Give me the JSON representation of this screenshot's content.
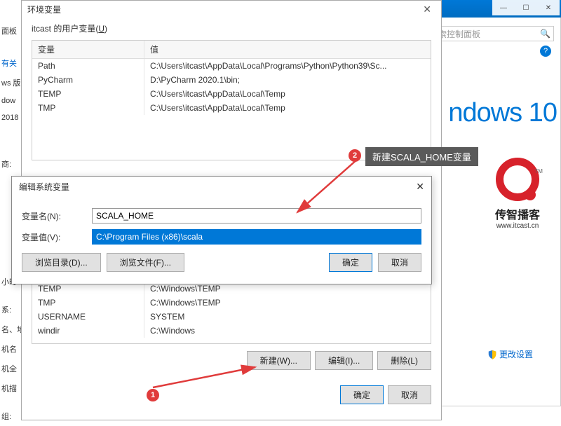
{
  "background": {
    "search_placeholder": "搜索控制面板",
    "windows_brand": "ndows 10",
    "logo_name": "传智播客",
    "logo_url": "www.itcast.cn",
    "change_settings": "更改设置",
    "left_items": [
      "面板",
      "有关",
      "ws 版",
      "dow",
      "2018",
      "商:",
      "小时",
      "系:",
      "名、地",
      "机名",
      "机全",
      "机描",
      "组:"
    ],
    "winbtns": [
      "—",
      "☐",
      "✕"
    ]
  },
  "env_window": {
    "title": "环境变量",
    "close": "✕",
    "user_group_label_pre": "itcast 的用户变量(",
    "user_group_label_u": "U",
    "user_group_label_post": ")",
    "col_var": "变量",
    "col_val": "值",
    "user_vars": [
      {
        "name": "Path",
        "value": "C:\\Users\\itcast\\AppData\\Local\\Programs\\Python\\Python39\\Sc..."
      },
      {
        "name": "PyCharm",
        "value": "D:\\PyCharm 2020.1\\bin;"
      },
      {
        "name": "TEMP",
        "value": "C:\\Users\\itcast\\AppData\\Local\\Temp"
      },
      {
        "name": "TMP",
        "value": "C:\\Users\\itcast\\AppData\\Local\\Temp"
      }
    ],
    "sys_vars_visible": [
      {
        "name": "TEMP",
        "value": "C:\\Windows\\TEMP"
      },
      {
        "name": "TMP",
        "value": "C:\\Windows\\TEMP"
      },
      {
        "name": "USERNAME",
        "value": "SYSTEM"
      },
      {
        "name": "windir",
        "value": "C:\\Windows"
      }
    ],
    "btn_new": "新建(W)...",
    "btn_edit": "编辑(I)...",
    "btn_delete": "删除(L)",
    "btn_ok": "确定",
    "btn_cancel": "取消"
  },
  "edit_dialog": {
    "title": "编辑系统变量",
    "close": "✕",
    "lbl_name": "变量名(N):",
    "val_name": "SCALA_HOME",
    "lbl_value": "变量值(V):",
    "val_value": "C:\\Program Files (x86)\\scala",
    "btn_browse_dir": "浏览目录(D)...",
    "btn_browse_file": "浏览文件(F)...",
    "btn_ok": "确定",
    "btn_cancel": "取消"
  },
  "annotations": {
    "callout2": "新建SCALA_HOME变量",
    "badge1": "1",
    "badge2": "2"
  }
}
